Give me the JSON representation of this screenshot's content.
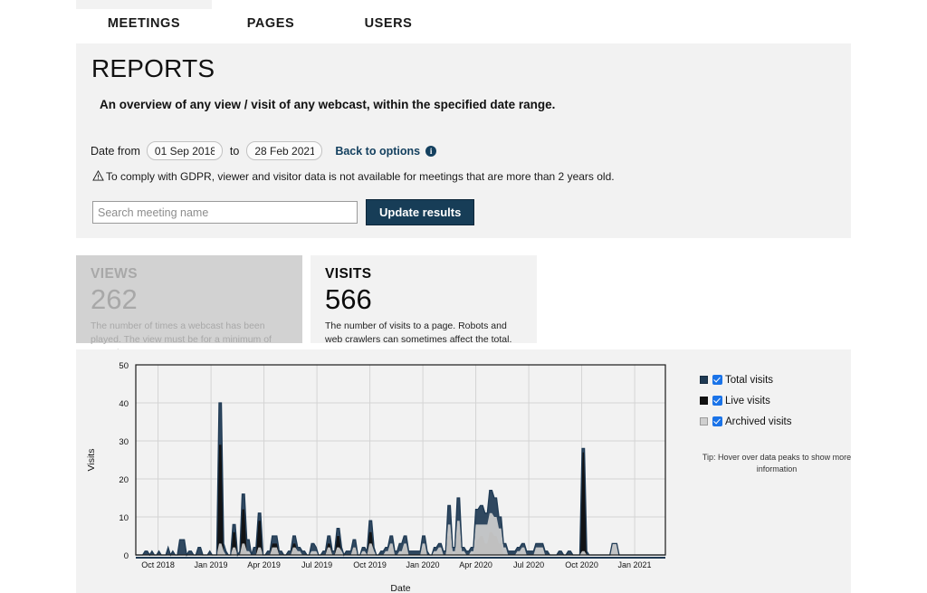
{
  "tabs": [
    {
      "id": "meetings",
      "label": "MEETINGS",
      "active": true
    },
    {
      "id": "pages",
      "label": "PAGES",
      "active": false
    },
    {
      "id": "users",
      "label": "USERS",
      "active": false
    }
  ],
  "header": {
    "title": "REPORTS",
    "subtitle": "An overview of any view / visit of any webcast, within the specified date range."
  },
  "filters": {
    "date_from_label": "Date from",
    "date_from_value": "01 Sep 2018",
    "to_label": "to",
    "date_to_value": "28 Feb 2021",
    "back_to_options": "Back to options",
    "info_icon": "info-icon",
    "gdpr_icon": "warning-triangle-icon",
    "gdpr_notice": "To comply with GDPR, viewer and visitor data is not available for meetings that are more than 2 years old.",
    "search_placeholder": "Search meeting name",
    "search_value": "",
    "update_button": "Update results"
  },
  "cards": [
    {
      "id": "views",
      "title": "VIEWS",
      "value": "262",
      "description": "The number of times a webcast has been played. The view must be for a minimum of one minute.",
      "bg_color": "#d2d2d2",
      "text_color": "#a8a8a8"
    },
    {
      "id": "visits",
      "title": "VISITS",
      "value": "566",
      "description": "The number of visits to a page. Robots and web crawlers can sometimes affect the total.",
      "bg_color": "#f2f2f2",
      "text_color": "#0c0c0c"
    }
  ],
  "legend": {
    "items": [
      {
        "label": "Total visits",
        "color": "#1f3a54",
        "checked": true
      },
      {
        "label": "Live visits",
        "color": "#111111",
        "checked": true
      },
      {
        "label": "Archived visits",
        "color": "#cfcfcf",
        "checked": true
      }
    ],
    "tip": "Tip: Hover over data peaks to show more information"
  },
  "chart_data": {
    "type": "area",
    "title": "",
    "xlabel": "Date",
    "ylabel": "Visits",
    "ylim": [
      0,
      50
    ],
    "yticks": [
      0,
      10,
      20,
      30,
      40,
      50
    ],
    "grid": true,
    "legend_position": "right",
    "xticks": [
      "Oct 2018",
      "Jan 2019",
      "Apr 2019",
      "Jul 2019",
      "Oct 2019",
      "Jan 2020",
      "Apr 2020",
      "Jul 2020",
      "Oct 2020",
      "Jan 2021"
    ],
    "x_range": [
      "Sep 2018",
      "Feb 2021"
    ],
    "series": [
      {
        "name": "Total visits",
        "color": "#1f3a54",
        "values": [
          0,
          0,
          0,
          0,
          1,
          1,
          0,
          1,
          0,
          0,
          1,
          0,
          0,
          0,
          2,
          0,
          1,
          0,
          0,
          4,
          4,
          4,
          0,
          1,
          1,
          0,
          0,
          2,
          2,
          0,
          0,
          0,
          1,
          0,
          0,
          0,
          40,
          40,
          3,
          1,
          0,
          0,
          8,
          8,
          0,
          1,
          16,
          16,
          4,
          4,
          0,
          2,
          2,
          11,
          11,
          0,
          0,
          1,
          1,
          5,
          5,
          5,
          1,
          1,
          0,
          0,
          1,
          1,
          5,
          5,
          2,
          2,
          1,
          1,
          0,
          0,
          3,
          3,
          2,
          0,
          0,
          1,
          1,
          5,
          5,
          1,
          1,
          7,
          7,
          2,
          0,
          1,
          1,
          1,
          4,
          4,
          0,
          0,
          2,
          2,
          1,
          9,
          9,
          2,
          0,
          0,
          1,
          1,
          2,
          2,
          5,
          5,
          1,
          1,
          3,
          3,
          5,
          5,
          1,
          1,
          1,
          1,
          1,
          1,
          5,
          5,
          1,
          0,
          0,
          2,
          2,
          3,
          3,
          1,
          1,
          13,
          13,
          2,
          2,
          15,
          15,
          2,
          2,
          1,
          1,
          2,
          2,
          12,
          12,
          13,
          13,
          11,
          11,
          17,
          17,
          15,
          15,
          10,
          10,
          3,
          3,
          1,
          1,
          1,
          1,
          2,
          2,
          3,
          3,
          1,
          1,
          1,
          1,
          3,
          3,
          3,
          3,
          1,
          1,
          0,
          0,
          0,
          0,
          1,
          1,
          0,
          0,
          1,
          1,
          0,
          0,
          0,
          0,
          28,
          28,
          1,
          0,
          0,
          0,
          0,
          0,
          0,
          0,
          0,
          0,
          0,
          3,
          3,
          3,
          0,
          0,
          0,
          0,
          0,
          0,
          0,
          0,
          0,
          0,
          0,
          0,
          0,
          0,
          0,
          0,
          0,
          0,
          0,
          0,
          0
        ]
      },
      {
        "name": "Live visits",
        "color": "#111111",
        "values": [
          0,
          0,
          0,
          0,
          0,
          0,
          0,
          0,
          0,
          0,
          0,
          0,
          0,
          0,
          0,
          0,
          0,
          0,
          0,
          0,
          0,
          0,
          0,
          0,
          0,
          0,
          0,
          0,
          0,
          0,
          0,
          0,
          0,
          0,
          0,
          0,
          29,
          29,
          0,
          0,
          0,
          0,
          6,
          6,
          0,
          0,
          12,
          12,
          0,
          0,
          0,
          0,
          0,
          9,
          9,
          0,
          0,
          0,
          0,
          3,
          3,
          3,
          0,
          0,
          0,
          0,
          0,
          0,
          3,
          3,
          0,
          0,
          0,
          0,
          0,
          0,
          0,
          0,
          0,
          0,
          0,
          0,
          0,
          3,
          3,
          0,
          0,
          5,
          5,
          0,
          0,
          0,
          0,
          0,
          2,
          2,
          0,
          0,
          0,
          0,
          0,
          6,
          6,
          0,
          0,
          0,
          0,
          0,
          0,
          0,
          2,
          2,
          0,
          0,
          0,
          0,
          2,
          2,
          0,
          0,
          0,
          0,
          0,
          0,
          2,
          2,
          0,
          0,
          0,
          0,
          0,
          0,
          0,
          0,
          0,
          5,
          5,
          0,
          0,
          6,
          6,
          0,
          0,
          0,
          0,
          0,
          0,
          4,
          4,
          5,
          5,
          3,
          3,
          6,
          6,
          5,
          5,
          3,
          3,
          0,
          0,
          0,
          0,
          0,
          0,
          0,
          0,
          0,
          0,
          0,
          0,
          0,
          0,
          0,
          0,
          0,
          0,
          0,
          0,
          0,
          0,
          0,
          0,
          0,
          0,
          0,
          0,
          0,
          0,
          0,
          0,
          0,
          0,
          27,
          27,
          0,
          0,
          0,
          0,
          0,
          0,
          0,
          0,
          0,
          0,
          0,
          0,
          0,
          0,
          0,
          0,
          0,
          0,
          0,
          0,
          0,
          0,
          0,
          0,
          0,
          0,
          0,
          0,
          0,
          0,
          0,
          0,
          0,
          0,
          0
        ]
      },
      {
        "name": "Archived visits",
        "color": "#cfcfcf",
        "values": [
          0,
          0,
          0,
          0,
          0,
          0,
          0,
          0,
          0,
          0,
          0,
          0,
          0,
          0,
          0,
          0,
          0,
          0,
          0,
          0,
          0,
          0,
          0,
          0,
          0,
          0,
          0,
          0,
          0,
          0,
          0,
          0,
          0,
          0,
          0,
          0,
          3,
          3,
          1,
          0,
          0,
          0,
          2,
          2,
          0,
          0,
          3,
          3,
          1,
          1,
          0,
          0,
          0,
          2,
          2,
          0,
          0,
          0,
          0,
          2,
          2,
          2,
          0,
          0,
          0,
          0,
          0,
          0,
          2,
          2,
          1,
          1,
          0,
          0,
          0,
          0,
          1,
          1,
          1,
          0,
          0,
          0,
          0,
          2,
          2,
          0,
          0,
          2,
          2,
          1,
          0,
          0,
          0,
          0,
          2,
          2,
          0,
          0,
          1,
          1,
          0,
          3,
          3,
          1,
          0,
          0,
          0,
          0,
          1,
          1,
          3,
          3,
          0,
          0,
          1,
          1,
          3,
          3,
          0,
          0,
          0,
          0,
          0,
          0,
          3,
          3,
          0,
          0,
          0,
          1,
          1,
          2,
          2,
          0,
          0,
          8,
          8,
          1,
          1,
          9,
          9,
          1,
          1,
          0,
          0,
          1,
          1,
          8,
          8,
          8,
          8,
          8,
          8,
          11,
          11,
          10,
          10,
          7,
          7,
          2,
          2,
          0,
          0,
          0,
          0,
          1,
          1,
          2,
          2,
          0,
          0,
          0,
          0,
          2,
          2,
          2,
          2,
          0,
          0,
          0,
          0,
          0,
          0,
          0,
          0,
          0,
          0,
          0,
          0,
          0,
          0,
          0,
          0,
          1,
          1,
          0,
          0,
          0,
          0,
          0,
          0,
          0,
          0,
          0,
          0,
          0,
          3,
          3,
          3,
          0,
          0,
          0,
          0,
          0,
          0,
          0,
          0,
          0,
          0,
          0,
          0,
          0,
          0,
          0,
          0,
          0,
          0,
          0,
          0,
          0
        ]
      }
    ]
  }
}
